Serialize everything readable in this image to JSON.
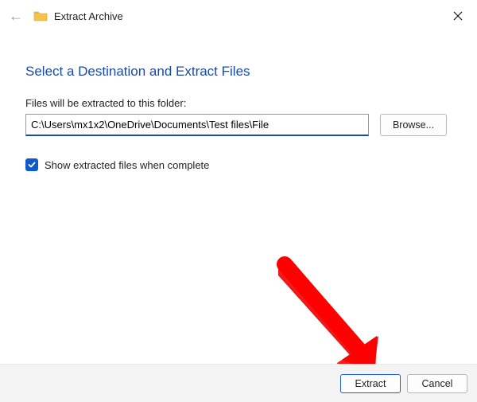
{
  "titlebar": {
    "back_icon": "←",
    "title": "Extract Archive"
  },
  "content": {
    "heading": "Select a Destination and Extract Files",
    "path_label": "Files will be extracted to this folder:",
    "path_value": "C:\\Users\\mx1x2\\OneDrive\\Documents\\Test files\\File",
    "browse_label": "Browse...",
    "show_files_label": "Show extracted files when complete",
    "show_files_checked": true
  },
  "footer": {
    "extract_label": "Extract",
    "cancel_label": "Cancel"
  },
  "colors": {
    "accent": "#1a4aa8",
    "checkbox": "#105bcc"
  }
}
